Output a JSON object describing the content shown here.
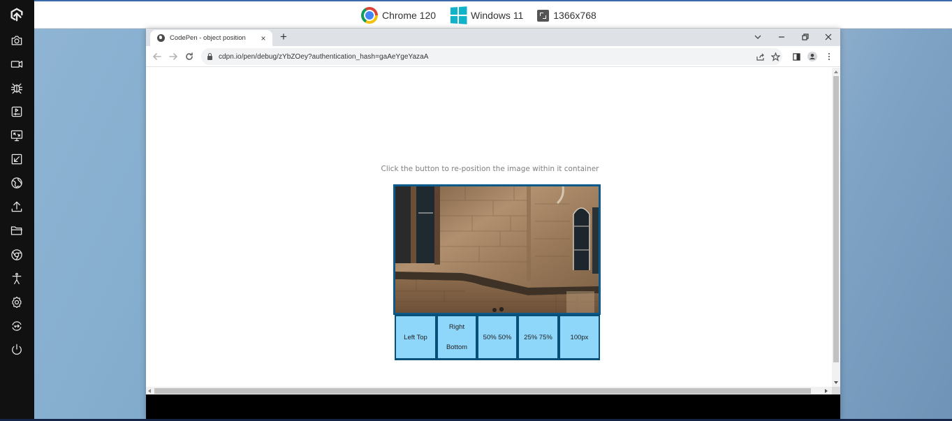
{
  "topbar": {
    "browser_label": "Chrome 120",
    "os_label": "Windows 11",
    "resolution_label": "1366x768"
  },
  "sidebar": {
    "items": [
      {
        "icon": "lambdatest-logo-icon"
      },
      {
        "icon": "camera-icon"
      },
      {
        "icon": "video-icon"
      },
      {
        "icon": "bug-icon"
      },
      {
        "icon": "play-timeline-icon"
      },
      {
        "icon": "monitor-resize-icon"
      },
      {
        "icon": "external-arrow-icon"
      },
      {
        "icon": "globe-icon"
      },
      {
        "icon": "upload-icon"
      },
      {
        "icon": "folder-icon"
      },
      {
        "icon": "chrome-icon"
      },
      {
        "icon": "accessibility-icon"
      },
      {
        "icon": "settings-icon"
      },
      {
        "icon": "switch-icon"
      },
      {
        "icon": "power-icon"
      }
    ]
  },
  "browser": {
    "tab": {
      "title": "CodePen - object position",
      "close": "×"
    },
    "new_tab": "+",
    "url": "cdpn.io/pen/debug/zYbZOey?authentication_hash=gaAeYgeYazaA"
  },
  "page": {
    "instruction": "Click the button to re-position the image within it container",
    "image_alt": "stone building facade with arched windows",
    "buttons": [
      {
        "label_line1": "Left Top",
        "label_line2": ""
      },
      {
        "label_line1": "Right",
        "label_line2": "Bottom"
      },
      {
        "label_line1": "50% 50%",
        "label_line2": ""
      },
      {
        "label_line1": "25% 75%",
        "label_line2": ""
      },
      {
        "label_line1": "100px",
        "label_line2": ""
      }
    ],
    "colors": {
      "container_border": "#0b5a8a",
      "button_bg": "#8fd6fb"
    }
  }
}
